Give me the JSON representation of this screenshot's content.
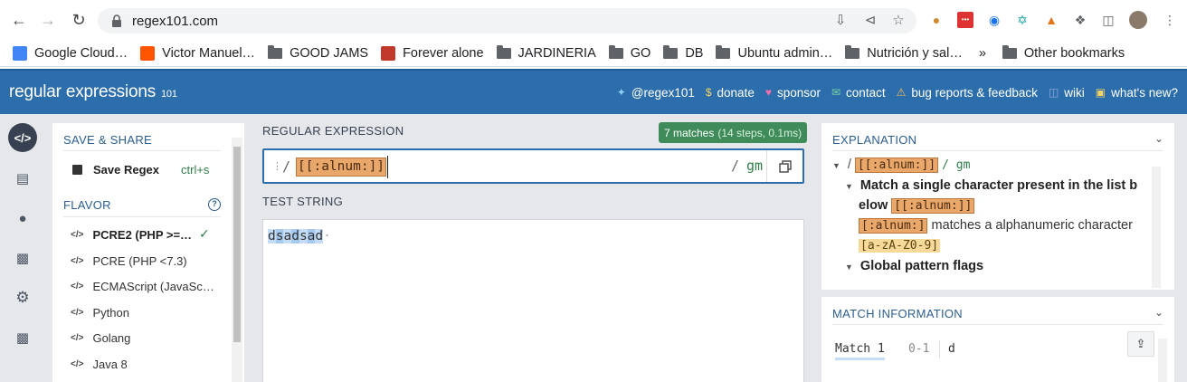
{
  "browser": {
    "url": "regex101.com",
    "bookmarks": [
      {
        "label": "Google Cloud…",
        "type": "fav",
        "color": "#4285f4"
      },
      {
        "label": "Victor Manuel…",
        "type": "fav",
        "color": "#ff5500"
      },
      {
        "label": "GOOD JAMS",
        "type": "folder"
      },
      {
        "label": "Forever alone",
        "type": "fav",
        "color": "#c0392b"
      },
      {
        "label": "JARDINERIA",
        "type": "folder"
      },
      {
        "label": "GO",
        "type": "folder"
      },
      {
        "label": "DB",
        "type": "folder"
      },
      {
        "label": "Ubuntu admin…",
        "type": "folder"
      },
      {
        "label": "Nutrición y sal…",
        "type": "folder"
      }
    ],
    "more_label": "»",
    "other_bookmarks": "Other bookmarks"
  },
  "site": {
    "logo_main": "regular expressions",
    "logo_version": "101",
    "links": [
      {
        "label": "@regex101",
        "icon": "twitter-icon"
      },
      {
        "label": "donate",
        "icon": "dollar-icon"
      },
      {
        "label": "sponsor",
        "icon": "heart-icon"
      },
      {
        "label": "contact",
        "icon": "mail-icon"
      },
      {
        "label": "bug reports & feedback",
        "icon": "warning-icon"
      },
      {
        "label": "wiki",
        "icon": "book-icon"
      },
      {
        "label": "what's new?",
        "icon": "news-icon"
      }
    ]
  },
  "sidebar": {
    "save_share_title": "SAVE & SHARE",
    "save_label": "Save Regex",
    "save_shortcut": "ctrl+s",
    "flavor_title": "FLAVOR",
    "flavors": [
      "PCRE2 (PHP >=…",
      "PCRE (PHP <7.3)",
      "ECMAScript (JavaSc…",
      "Python",
      "Golang",
      "Java 8"
    ],
    "selected_flavor_index": 0
  },
  "regex": {
    "section_title": "REGULAR EXPRESSION",
    "match_count": "7 matches",
    "match_detail": "(14 steps, 0.1ms)",
    "delimiter": "/",
    "pattern": "[[:alnum:]]",
    "flags": "gm",
    "test_title": "TEST STRING",
    "test_string": "dsadsad"
  },
  "explanation": {
    "title": "EXPLANATION",
    "root_slash": "/",
    "pattern": "[[:alnum:]]",
    "flags_text": "/ gm",
    "item1_text_a": "Match a single character present in the list b",
    "item1_text_b": "elow",
    "item1_token": "[[:alnum:]]",
    "sub_token": "[:alnum:]",
    "sub_text": "matches a alphanumeric character",
    "range_token": "[a-zA-Z0-9]",
    "item2_text": "Global pattern flags"
  },
  "match_info": {
    "title": "MATCH INFORMATION",
    "match_label": "Match 1",
    "range": "0-1",
    "value": "d"
  },
  "colors": {
    "header_blue": "#2c6eab",
    "match_green": "#3f8c5a",
    "token_orange": "#e9a86a"
  }
}
